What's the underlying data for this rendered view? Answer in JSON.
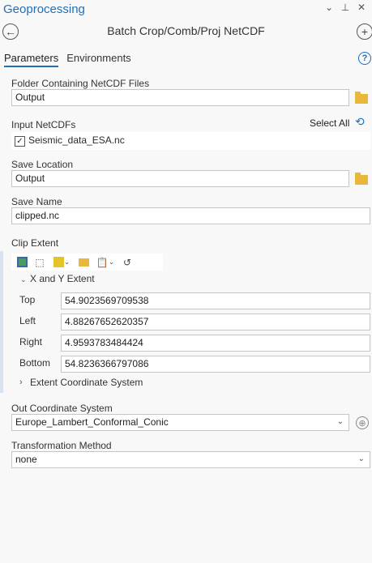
{
  "header": {
    "pane_title": "Geoprocessing",
    "tool_title": "Batch Crop/Comb/Proj NetCDF",
    "icons": [
      "chevron-down-icon",
      "pin-icon",
      "close-icon",
      "back-icon",
      "add-icon",
      "help-icon"
    ]
  },
  "tabs": [
    {
      "label": "Parameters",
      "active": true
    },
    {
      "label": "Environments",
      "active": false
    }
  ],
  "params": {
    "folder_label": "Folder Containing NetCDF Files",
    "folder_value": "Output",
    "input_label": "Input NetCDFs",
    "select_all": "Select All",
    "netcdf_item": "Seismic_data_ESA.nc",
    "netcdf_checked": true,
    "save_location_label": "Save Location",
    "save_location_value": "Output",
    "save_name_label": "Save Name",
    "save_name_value": "clipped.nc",
    "clip_extent_label": "Clip Extent",
    "xy_extent_label": "X and Y Extent",
    "extent": {
      "top_label": "Top",
      "top_value": "54.9023569709538",
      "left_label": "Left",
      "left_value": "4.88267652620357",
      "right_label": "Right",
      "right_value": "4.9593783484424",
      "bottom_label": "Bottom",
      "bottom_value": "54.8236366797086"
    },
    "extent_cs_label": "Extent Coordinate System",
    "out_cs_label": "Out Coordinate System",
    "out_cs_value": "Europe_Lambert_Conformal_Conic",
    "transform_label": "Transformation Method",
    "transform_value": "none"
  },
  "colors": {
    "accent": "#1f6fb5",
    "folder": "#e8b83a"
  }
}
